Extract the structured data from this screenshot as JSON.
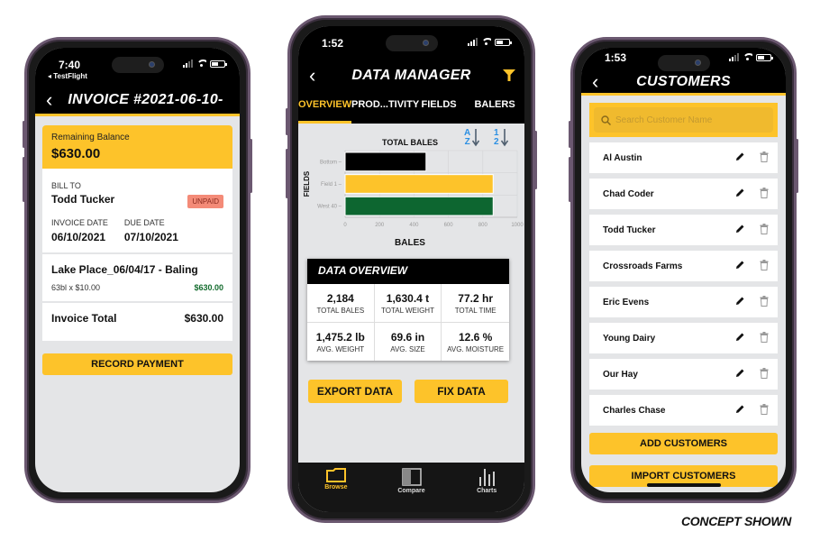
{
  "colors": {
    "accent_yellow": "#fdc32a",
    "header_black": "#000000",
    "background_gray": "#e4e5e7",
    "paid_green": "#146c2e",
    "unpaid_badge": "#f48b78",
    "bar_black": "#000000",
    "bar_yellow": "#fdc32a",
    "bar_green": "#0d6630",
    "sort_blue": "#2b8fe3",
    "frame_purple": "#6b5870"
  },
  "invoice_screen": {
    "status": {
      "time": "7:40",
      "back_app": "◂ TestFlight"
    },
    "nav": {
      "back_icon": "‹",
      "title": "INVOICE #2021-06-10-"
    },
    "balance": {
      "label": "Remaining Balance",
      "amount": "$630.00"
    },
    "bill_to": {
      "label": "BILL TO",
      "name": "Todd Tucker",
      "status_badge": "UNPAID",
      "invoice_date_label": "INVOICE DATE",
      "invoice_date": "06/10/2021",
      "due_date_label": "DUE DATE",
      "due_date": "07/10/2021"
    },
    "line_item": {
      "title": "Lake Place_06/04/17 - Baling",
      "detail": "63bl x $10.00",
      "amount": "$630.00"
    },
    "total": {
      "label": "Invoice Total",
      "amount": "$630.00"
    },
    "record_payment_label": "RECORD PAYMENT"
  },
  "data_manager_screen": {
    "status": {
      "time": "1:52"
    },
    "nav": {
      "back_icon": "‹",
      "title": "DATA MANAGER",
      "filter_icon": "filter"
    },
    "tabs": [
      {
        "label": "OVERVIEW",
        "active": true
      },
      {
        "label": "PROD...TIVITY",
        "active": false
      },
      {
        "label": "FIELDS",
        "active": false
      },
      {
        "label": "BALERS",
        "active": false
      }
    ],
    "sort_alpha": {
      "top": "A",
      "bottom": "Z"
    },
    "sort_numeric": {
      "top": "1",
      "bottom": "2"
    },
    "overview": {
      "title": "DATA OVERVIEW",
      "stats": [
        {
          "value": "2,184",
          "label": "TOTAL BALES"
        },
        {
          "value": "1,630.4 t",
          "label": "TOTAL WEIGHT"
        },
        {
          "value": "77.2 hr",
          "label": "TOTAL TIME"
        },
        {
          "value": "1,475.2 lb",
          "label": "AVG. WEIGHT"
        },
        {
          "value": "69.6 in",
          "label": "AVG. SIZE"
        },
        {
          "value": "12.6 %",
          "label": "AVG. MOISTURE"
        }
      ]
    },
    "export_label": "EXPORT DATA",
    "fix_label": "FIX DATA",
    "tabbar": [
      {
        "label": "Browse",
        "icon": "folder-icon",
        "active": true
      },
      {
        "label": "Compare",
        "icon": "compare-icon",
        "active": false
      },
      {
        "label": "Charts",
        "icon": "bar-chart-icon",
        "active": false
      }
    ]
  },
  "chart_data": {
    "type": "bar",
    "orientation": "horizontal",
    "title": "TOTAL BALES",
    "xlabel": "BALES",
    "ylabel": "FIELDS",
    "categories": [
      "Bottom",
      "Field 1",
      "West 40"
    ],
    "values": [
      470,
      860,
      860
    ],
    "bar_colors": [
      "#000000",
      "#fdc32a",
      "#0d6630"
    ],
    "xlim": [
      0,
      1000
    ],
    "xticks": [
      0,
      200,
      400,
      600,
      800,
      1000
    ],
    "grid": true,
    "legend": "none"
  },
  "customers_screen": {
    "status": {
      "time": "1:53"
    },
    "nav": {
      "back_icon": "‹",
      "title": "CUSTOMERS"
    },
    "search_placeholder": "Search Customer Name",
    "customers": [
      {
        "name": "Al Austin"
      },
      {
        "name": "Chad Coder"
      },
      {
        "name": "Todd Tucker"
      },
      {
        "name": "Crossroads Farms"
      },
      {
        "name": "Eric Evens"
      },
      {
        "name": "Young Dairy"
      },
      {
        "name": "Our Hay"
      },
      {
        "name": "Charles Chase"
      }
    ],
    "add_label": "ADD CUSTOMERS",
    "import_label": "IMPORT CUSTOMERS"
  },
  "caption": "CONCEPT SHOWN"
}
